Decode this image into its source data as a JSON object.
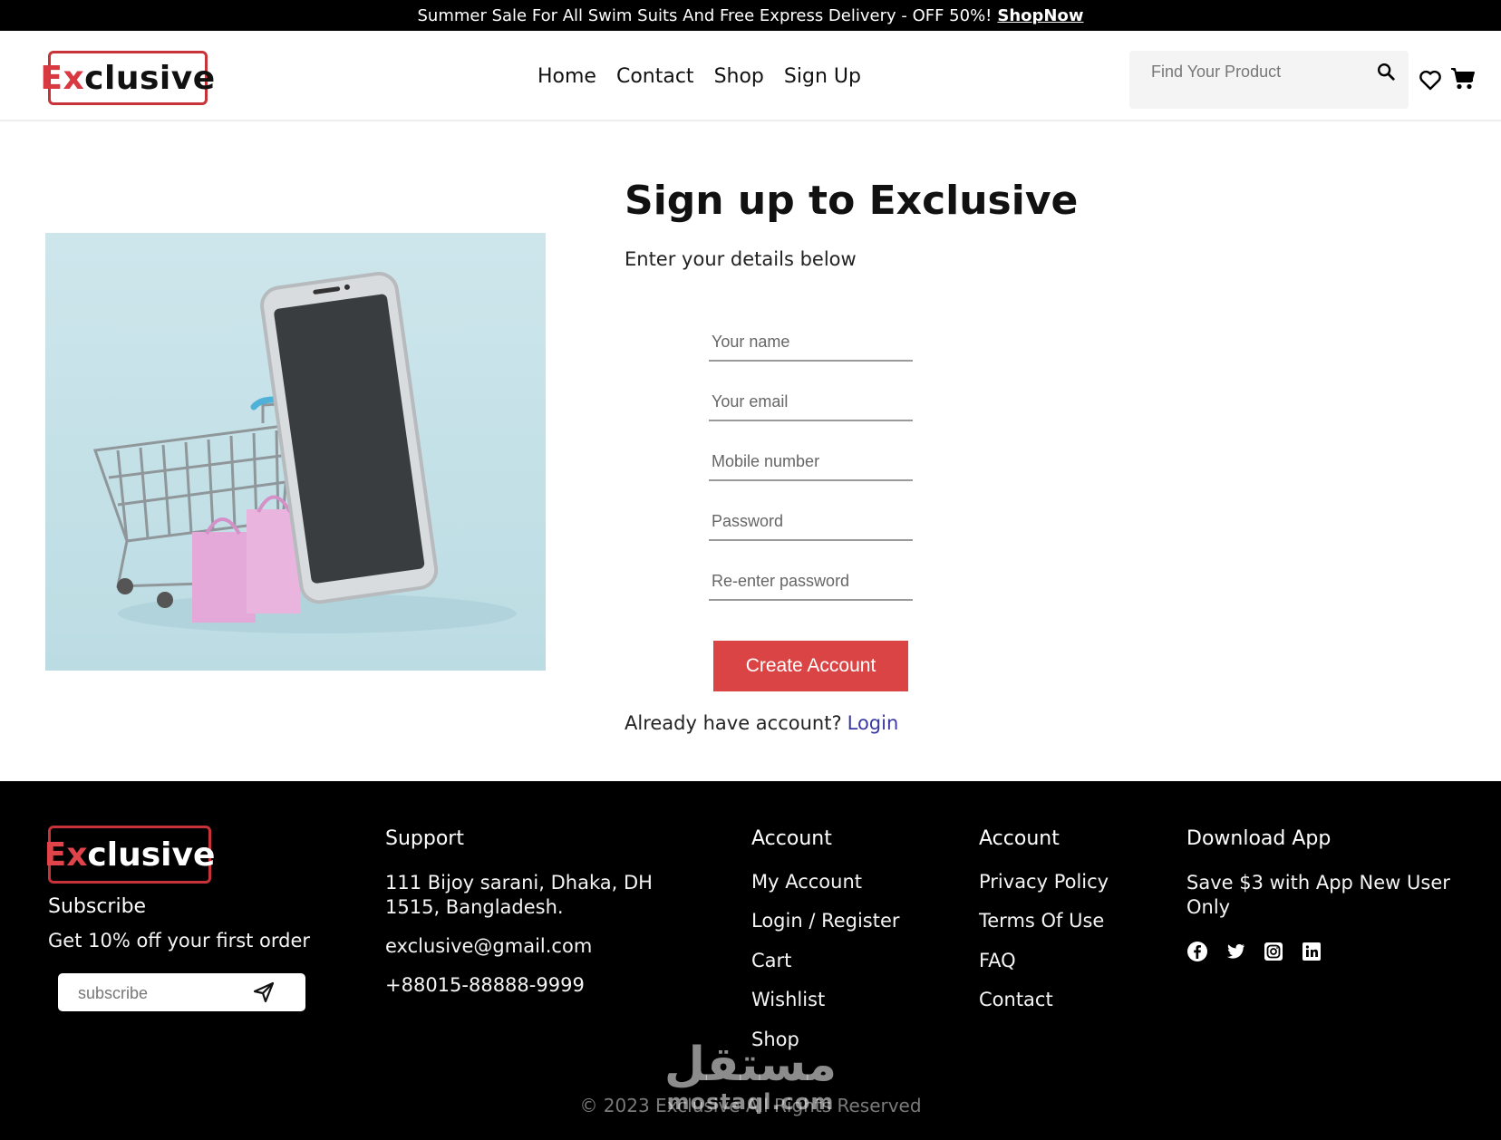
{
  "banner": {
    "text": "Summer Sale For All Swim Suits And Free Express Delivery - OFF 50%!",
    "link": "ShopNow"
  },
  "header": {
    "logo_accent": "Ex",
    "logo_rest": "clusive",
    "nav": [
      "Home",
      "Contact",
      "Shop",
      "Sign Up"
    ],
    "search_placeholder": "Find Your Product",
    "icons": [
      "search-icon",
      "heart-icon",
      "cart-icon"
    ]
  },
  "hero": {
    "image": "shopping-cart-with-phone-and-bags"
  },
  "signup": {
    "title": "Sign up to Exclusive",
    "subtitle": "Enter your details below",
    "fields": [
      {
        "placeholder": "Your name",
        "value": ""
      },
      {
        "placeholder": "Your email",
        "value": ""
      },
      {
        "placeholder": "Mobile number",
        "value": ""
      },
      {
        "placeholder": "Password",
        "value": ""
      },
      {
        "placeholder": "Re-enter password",
        "value": ""
      }
    ],
    "button": "Create Account",
    "already_text": "Already have account?",
    "login_link": "Login"
  },
  "footer": {
    "logo_accent": "Ex",
    "logo_rest": "clusive",
    "subscribe_heading": "Subscribe",
    "subscribe_text": "Get 10% off your first order",
    "subscribe_placeholder": "subscribe",
    "support": {
      "heading": "Support",
      "address_line1": "111 Bijoy sarani, Dhaka, DH",
      "address_line2": "1515, Bangladesh.",
      "email": "exclusive@gmail.com",
      "phone": "+88015-88888-9999"
    },
    "account1": {
      "heading": "Account",
      "links": [
        "My Account",
        "Login / Register",
        "Cart",
        "Wishlist",
        "Shop"
      ]
    },
    "account2": {
      "heading": "Account",
      "links": [
        "Privacy Policy",
        "Terms Of Use",
        "FAQ",
        "Contact"
      ]
    },
    "download": {
      "heading": "Download App",
      "text_line1": "Save $3 with App New User",
      "text_line2": "Only"
    },
    "social_icons": [
      "facebook-icon",
      "twitter-icon",
      "instagram-icon",
      "linkedin-icon"
    ],
    "copyright": "© 2023 Exclusive All Rights Reserved",
    "watermark_arabic": "مستقل",
    "watermark_latin": "mostaql.com"
  },
  "colors": {
    "accent": "#db4444",
    "link": "#3a37a6",
    "banner_bg": "#000000",
    "footer_bg": "#000000"
  }
}
